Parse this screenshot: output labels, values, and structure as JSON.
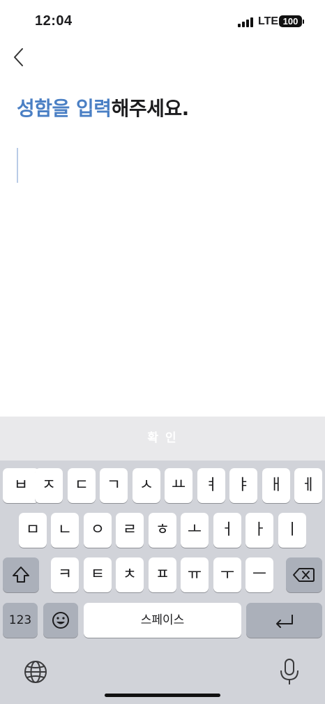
{
  "status_bar": {
    "time": "12:04",
    "network": "LTE",
    "battery": "100"
  },
  "nav": {
    "back_icon": "chevron-left-icon"
  },
  "headline": {
    "accent": "성함을 입력",
    "rest": "해주세요."
  },
  "input": {
    "value": "",
    "placeholder": ""
  },
  "confirm_button": {
    "label": "확 인"
  },
  "keyboard": {
    "row1": [
      "ㅂ",
      "ㅈ",
      "ㄷ",
      "ㄱ",
      "ㅅ",
      "ㅛ",
      "ㅕ",
      "ㅑ",
      "ㅐ",
      "ㅔ"
    ],
    "row2": [
      "ㅁ",
      "ㄴ",
      "ㅇ",
      "ㄹ",
      "ㅎ",
      "ㅗ",
      "ㅓ",
      "ㅏ",
      "ㅣ"
    ],
    "row3": [
      "ㅋ",
      "ㅌ",
      "ㅊ",
      "ㅍ",
      "ㅠ",
      "ㅜ",
      "ㅡ"
    ],
    "numbers_label": "123",
    "space_label": "스페이스",
    "shift_icon": "shift-icon",
    "delete_icon": "delete-icon",
    "emoji_icon": "emoji-icon",
    "return_icon": "return-icon",
    "globe_icon": "globe-icon",
    "mic_icon": "microphone-icon"
  },
  "colors": {
    "accent": "#4a7fc4",
    "keyboard_bg": "#d1d3d9",
    "function_key": "#abb0ba",
    "confirm_bar": "#e9e9eb"
  }
}
